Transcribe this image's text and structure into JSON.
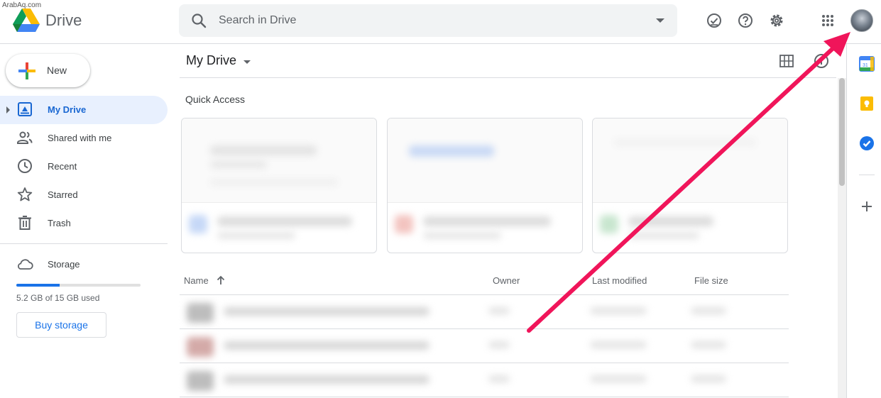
{
  "watermark": "ArabAq.com",
  "app": {
    "name": "Drive"
  },
  "search": {
    "placeholder": "Search in Drive"
  },
  "sidebar": {
    "new_label": "New",
    "items": [
      {
        "label": "My Drive",
        "icon": "my-drive-icon",
        "active": true
      },
      {
        "label": "Shared with me",
        "icon": "people-icon"
      },
      {
        "label": "Recent",
        "icon": "clock-icon"
      },
      {
        "label": "Starred",
        "icon": "star-icon"
      },
      {
        "label": "Trash",
        "icon": "trash-icon"
      }
    ],
    "storage": {
      "label": "Storage",
      "used_text": "5.2 GB of 15 GB used",
      "used_fraction": 0.347,
      "buy_label": "Buy storage"
    }
  },
  "main": {
    "title": "My Drive",
    "quick_access_title": "Quick Access",
    "table": {
      "columns": [
        "Name",
        "Owner",
        "Last modified",
        "File size"
      ]
    }
  },
  "colors": {
    "accent": "#1a73e8",
    "active_bg": "#e8f0fe",
    "arrow": "#f0155a"
  }
}
